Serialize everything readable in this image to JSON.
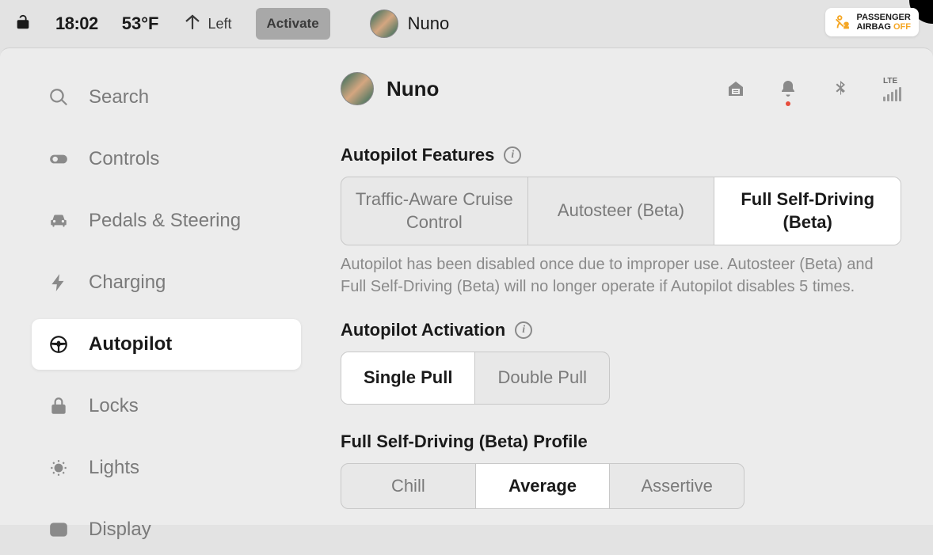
{
  "status": {
    "time": "18:02",
    "temperature": "53°F",
    "homelink_direction": "Left",
    "activate_label": "Activate",
    "profile_name": "Nuno",
    "airbag_line1": "PASSENGER",
    "airbag_line2": "AIRBAG",
    "airbag_state": "OFF",
    "signal_label": "LTE"
  },
  "sidebar": {
    "items": [
      {
        "label": "Search"
      },
      {
        "label": "Controls"
      },
      {
        "label": "Pedals & Steering"
      },
      {
        "label": "Charging"
      },
      {
        "label": "Autopilot"
      },
      {
        "label": "Locks"
      },
      {
        "label": "Lights"
      },
      {
        "label": "Display"
      }
    ]
  },
  "content": {
    "profile_name": "Nuno",
    "features": {
      "title": "Autopilot Features",
      "options": [
        "Traffic-Aware Cruise Control",
        "Autosteer (Beta)",
        "Full Self-Driving (Beta)"
      ],
      "warning": "Autopilot has been disabled once due to improper use. Autosteer (Beta) and Full Self-Driving (Beta) will no longer operate if Autopilot disables 5 times."
    },
    "activation": {
      "title": "Autopilot Activation",
      "options": [
        "Single Pull",
        "Double Pull"
      ]
    },
    "fsd_profile": {
      "title": "Full Self-Driving (Beta) Profile",
      "options": [
        "Chill",
        "Average",
        "Assertive"
      ]
    }
  }
}
